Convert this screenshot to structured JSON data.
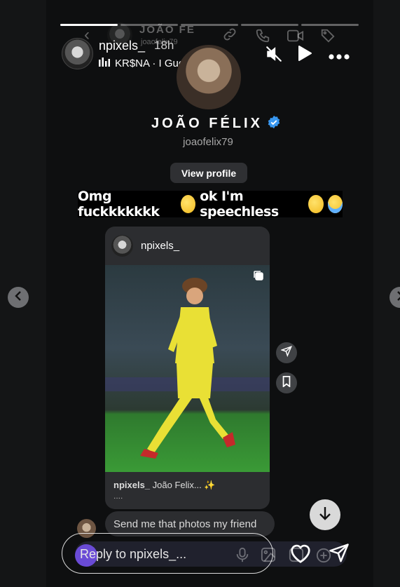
{
  "story": {
    "username": "npixels_",
    "time": "18h",
    "music": "KR$NA · I Guess",
    "progress_segments": 5,
    "progress_done": 1
  },
  "profile": {
    "name": "JOÃO FÉLIX",
    "handle": "joaofelix79",
    "view_profile": "View profile"
  },
  "background_header": {
    "name": "JOÃO FE",
    "handle": "joaofelix79"
  },
  "caption_banner": "Omg fuckkkkkkk",
  "caption_banner_2": "ok I'm speechless",
  "post": {
    "author": "npixels_",
    "caption_user": "npixels_",
    "caption_text": "João Felix... ✨",
    "more": "...."
  },
  "message": {
    "text": "Send me that photos my friend"
  },
  "reply": {
    "placeholder": "Reply to npixels_..."
  },
  "colors": {
    "verified": "#3897f0",
    "pitch": "#3a9a36",
    "kit": "#e9e035"
  }
}
